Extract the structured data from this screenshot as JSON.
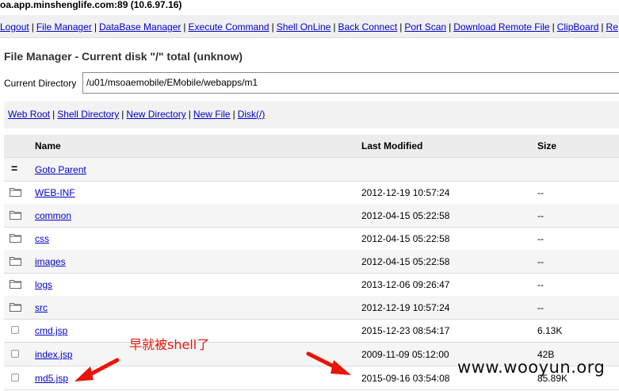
{
  "window": {
    "host": "oa.app.minshenglife.com:89 (10.6.97.16)"
  },
  "topnav": {
    "items": [
      "Logout",
      "File Manager",
      "DataBase Manager",
      "Execute Command",
      "Shell OnLine",
      "Back Connect",
      "Port Scan",
      "Download Remote File",
      "ClipBoard",
      "Re"
    ],
    "separator": "|"
  },
  "page": {
    "title": "File Manager - Current disk \"/\" total (unknow)"
  },
  "current_directory": {
    "label": "Current Directory",
    "value": "/u01/msoaemobile/EMobile/webapps/m1"
  },
  "actions": {
    "items": [
      "Web Root",
      "Shell Directory",
      "New Directory",
      "New File",
      "Disk(/)"
    ]
  },
  "table": {
    "headers": {
      "name": "Name",
      "modified": "Last Modified",
      "size": "Size"
    },
    "parent": {
      "symbol": "=",
      "label": "Goto Parent"
    },
    "rows": [
      {
        "type": "folder",
        "name": "WEB-INF",
        "modified": "2012-12-19 10:57:24",
        "size": "--"
      },
      {
        "type": "folder",
        "name": "common",
        "modified": "2012-04-15 05:22:58",
        "size": "--"
      },
      {
        "type": "folder",
        "name": "css",
        "modified": "2012-04-15 05:22:58",
        "size": "--"
      },
      {
        "type": "folder",
        "name": "images",
        "modified": "2012-04-15 05:22:58",
        "size": "--"
      },
      {
        "type": "folder",
        "name": "logs",
        "modified": "2013-12-06 09:26:47",
        "size": "--"
      },
      {
        "type": "folder",
        "name": "src",
        "modified": "2012-12-19 10:57:24",
        "size": "--"
      },
      {
        "type": "file",
        "name": "cmd.jsp",
        "modified": "2015-12-23 08:54:17",
        "size": "6.13K"
      },
      {
        "type": "file",
        "name": "index.jsp",
        "modified": "2009-11-09 05:12:00",
        "size": "42B"
      },
      {
        "type": "file",
        "name": "md5.jsp",
        "modified": "2015-09-16 03:54:08",
        "size": "85.89K"
      }
    ]
  },
  "annotation": {
    "text": "早就被shell了",
    "color": "#e8150a"
  },
  "watermark": {
    "text": "www.wooyun.org"
  },
  "colors": {
    "link": "#0000cc",
    "header_bg": "#ececec",
    "row_alt": "#f5f5f5",
    "arrow": "#e8150a"
  }
}
